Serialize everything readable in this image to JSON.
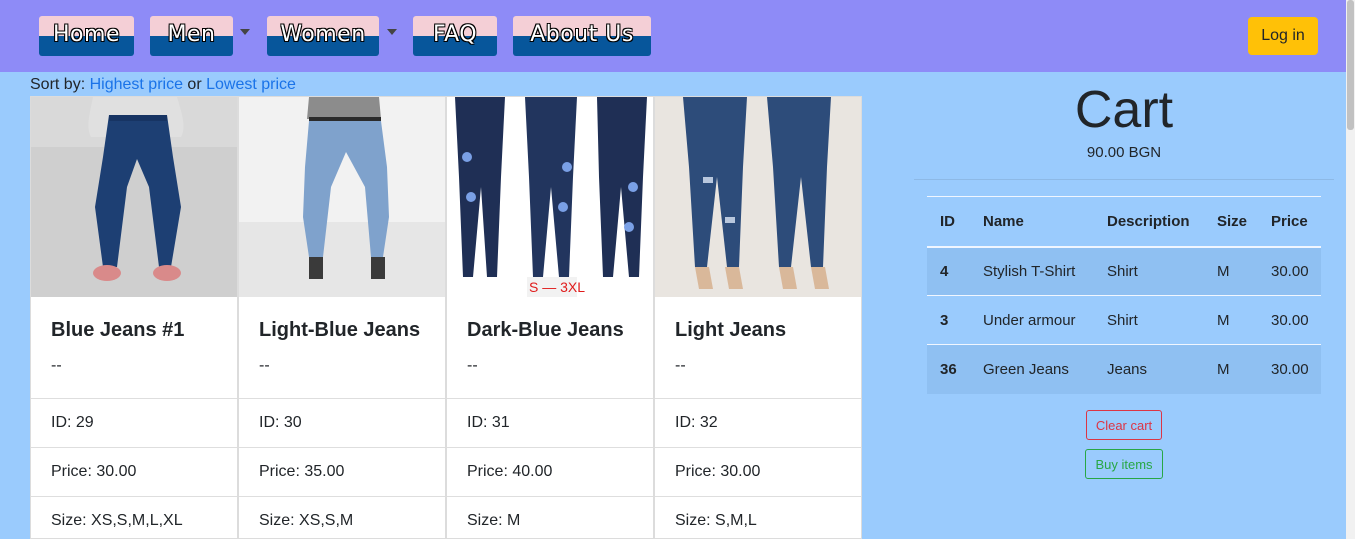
{
  "nav": {
    "home": "Home",
    "men": "Men",
    "women": "Women",
    "faq": "FAQ",
    "about": "About Us",
    "login": "Log in"
  },
  "sort": {
    "prefix": "Sort by:",
    "highest": "Highest price",
    "or": "or",
    "lowest": "Lowest price"
  },
  "products": [
    {
      "title": "Blue Jeans #1",
      "desc": "--",
      "id": "ID: 29",
      "price": "Price: 30.00",
      "size": "Size: XS,S,M,L,XL"
    },
    {
      "title": "Light-Blue Jeans",
      "desc": "--",
      "id": "ID: 30",
      "price": "Price: 35.00",
      "size": "Size: XS,S,M"
    },
    {
      "title": "Dark-Blue Jeans",
      "desc": "--",
      "id": "ID: 31",
      "price": "Price: 40.00",
      "size": "Size: M"
    },
    {
      "title": "Light Jeans",
      "desc": "--",
      "id": "ID: 32",
      "price": "Price: 30.00",
      "size": "Size: S,M,L"
    }
  ],
  "product_image_overlay": "S — 3XL",
  "cart": {
    "title": "Cart",
    "total": "90.00 BGN",
    "columns": [
      "ID",
      "Name",
      "Description",
      "Size",
      "Price"
    ],
    "rows": [
      [
        "4",
        "Stylish T-Shirt",
        "Shirt",
        "M",
        "30.00"
      ],
      [
        "3",
        "Under armour",
        "Shirt",
        "M",
        "30.00"
      ],
      [
        "36",
        "Green Jeans",
        "Jeans",
        "M",
        "30.00"
      ]
    ],
    "clear_label": "Clear cart",
    "buy_label": "Buy items"
  },
  "colors": {
    "navbar": "#8e8bf7",
    "page_bg": "#9acbfd",
    "login": "#ffc107",
    "danger": "#dc3545",
    "success": "#28a745"
  }
}
